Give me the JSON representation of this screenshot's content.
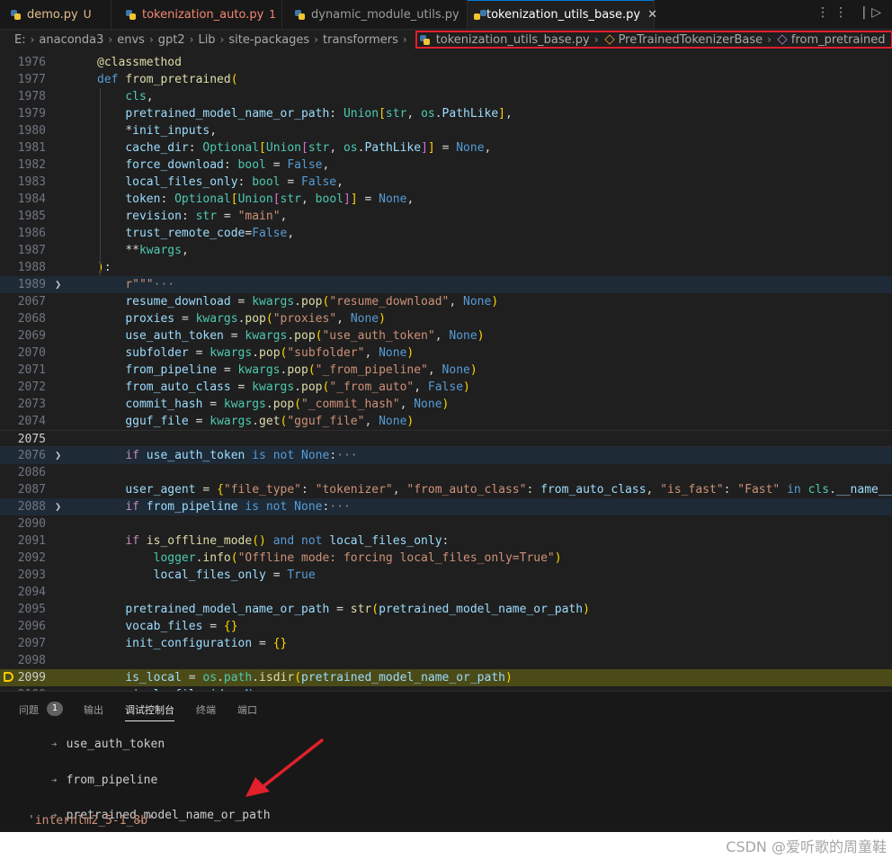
{
  "tabs": [
    {
      "label": "demo.py",
      "badge": "U",
      "color": "#e2c08d",
      "active": false
    },
    {
      "label": "tokenization_auto.py",
      "badge": "1",
      "color": "#f48771",
      "active": false
    },
    {
      "label": "dynamic_module_utils.py",
      "badge": "",
      "color": "#9d9d9d",
      "active": false
    },
    {
      "label": "tokenization_utils_base.py",
      "badge": "",
      "color": "#ffffff",
      "active": true,
      "close": "✕"
    }
  ],
  "tab_tools": "⋮⋮ |▷",
  "breadcrumb": {
    "path": [
      "E:",
      "anaconda3",
      "envs",
      "gpt2",
      "Lib",
      "site-packages",
      "transformers"
    ],
    "file": "tokenization_utils_base.py",
    "class": "PreTrainedTokenizerBase",
    "method": "from_pretrained"
  },
  "editor": {
    "lines": [
      {
        "n": "1976",
        "t": "@classmethod"
      },
      {
        "n": "1977",
        "t": "def from_pretrained("
      },
      {
        "n": "1978",
        "t": "    cls,"
      },
      {
        "n": "1979",
        "t": "    pretrained_model_name_or_path: Union[str, os.PathLike],"
      },
      {
        "n": "1980",
        "t": "    *init_inputs,"
      },
      {
        "n": "1981",
        "t": "    cache_dir: Optional[Union[str, os.PathLike]] = None,"
      },
      {
        "n": "1982",
        "t": "    force_download: bool = False,"
      },
      {
        "n": "1983",
        "t": "    local_files_only: bool = False,"
      },
      {
        "n": "1984",
        "t": "    token: Optional[Union[str, bool]] = None,"
      },
      {
        "n": "1985",
        "t": "    revision: str = \"main\","
      },
      {
        "n": "1986",
        "t": "    trust_remote_code=False,"
      },
      {
        "n": "1987",
        "t": "    **kwargs,"
      },
      {
        "n": "1988",
        "t": "):"
      },
      {
        "n": "1989",
        "t": "    r\"\"\"···",
        "fold": true
      },
      {
        "n": "2067",
        "t": "    resume_download = kwargs.pop(\"resume_download\", None)"
      },
      {
        "n": "2068",
        "t": "    proxies = kwargs.pop(\"proxies\", None)"
      },
      {
        "n": "2069",
        "t": "    use_auth_token = kwargs.pop(\"use_auth_token\", None)"
      },
      {
        "n": "2070",
        "t": "    subfolder = kwargs.pop(\"subfolder\", None)"
      },
      {
        "n": "2071",
        "t": "    from_pipeline = kwargs.pop(\"_from_pipeline\", None)"
      },
      {
        "n": "2072",
        "t": "    from_auto_class = kwargs.pop(\"_from_auto\", False)"
      },
      {
        "n": "2073",
        "t": "    commit_hash = kwargs.pop(\"_commit_hash\", None)"
      },
      {
        "n": "2074",
        "t": "    gguf_file = kwargs.get(\"gguf_file\", None)"
      },
      {
        "n": "2075",
        "t": "",
        "current": true
      },
      {
        "n": "2076",
        "t": "    if use_auth_token is not None:···",
        "fold": true
      },
      {
        "n": "2086",
        "t": ""
      },
      {
        "n": "2087",
        "t": "    user_agent = {\"file_type\": \"tokenizer\", \"from_auto_class\": from_auto_class, \"is_fast\": \"Fast\" in cls.__name__}"
      },
      {
        "n": "2088",
        "t": "    if from_pipeline is not None:···",
        "fold": true
      },
      {
        "n": "2090",
        "t": ""
      },
      {
        "n": "2091",
        "t": "    if is_offline_mode() and not local_files_only:"
      },
      {
        "n": "2092",
        "t": "        logger.info(\"Offline mode: forcing local_files_only=True\")"
      },
      {
        "n": "2093",
        "t": "        local_files_only = True"
      },
      {
        "n": "2094",
        "t": ""
      },
      {
        "n": "2095",
        "t": "    pretrained_model_name_or_path = str(pretrained_model_name_or_path)"
      },
      {
        "n": "2096",
        "t": "    vocab_files = {}"
      },
      {
        "n": "2097",
        "t": "    init_configuration = {}"
      },
      {
        "n": "2098",
        "t": ""
      },
      {
        "n": "2099",
        "t": "    is_local = os.path.isdir(pretrained_model_name_or_path)",
        "debug": true
      },
      {
        "n": "2100",
        "t": "    single_file_id = None"
      }
    ]
  },
  "panel": {
    "tabs": [
      "问题",
      "输出",
      "调试控制台",
      "终端",
      "端口"
    ],
    "problems_count": "1",
    "active_tab": "调试控制台",
    "entries": [
      {
        "expr": "use_auth_token",
        "result": ""
      },
      {
        "expr": "from_pipeline",
        "result": ""
      },
      {
        "expr": "pretrained_model_name_or_path",
        "result": "'internlm2_5-1_8b'"
      }
    ],
    "prompt_icon": "➔"
  },
  "watermark": "CSDN @爱听歌的周童鞋",
  "colors": {
    "accent": "#0078d4",
    "highlight_box": "#e0202c",
    "annotation_arrow": "#e0202c",
    "debug_line": "#4b4b18"
  }
}
